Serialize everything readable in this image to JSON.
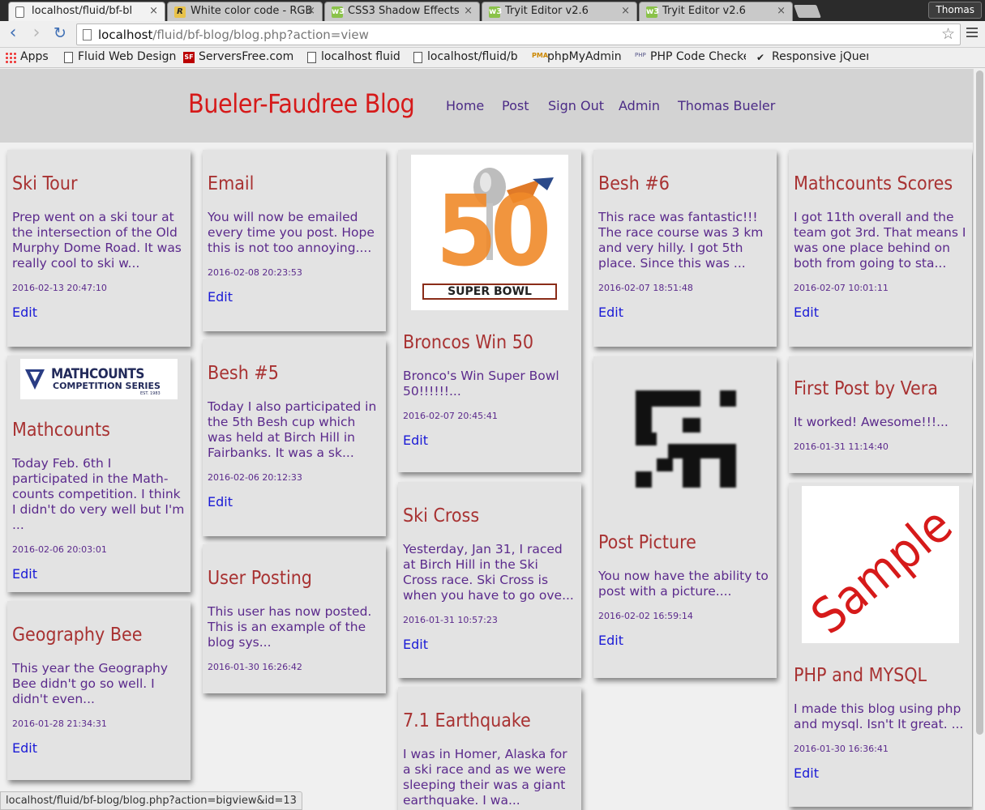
{
  "browser": {
    "tabs": [
      {
        "title": "localhost/fluid/bf-bl",
        "icon": "page-icon",
        "active": true
      },
      {
        "title": "White color code - RGB",
        "icon": "r-logo-icon"
      },
      {
        "title": "CSS3 Shadow Effects",
        "icon": "w3-logo-icon"
      },
      {
        "title": "Tryit Editor v2.6",
        "icon": "w3-logo-icon"
      },
      {
        "title": "Tryit Editor v2.6",
        "icon": "w3-logo-icon"
      }
    ],
    "profile_name": "Thomas",
    "url_host": "localhost",
    "url_path": "/fluid/bf-blog/blog.php?action=view",
    "bookmarks": [
      {
        "label": "Apps",
        "icon": "apps-grid-icon"
      },
      {
        "label": "Fluid Web Design",
        "icon": "page-icon"
      },
      {
        "label": "ServersFree.com",
        "icon": "sf-logo-icon"
      },
      {
        "label": "localhost fluid",
        "icon": "page-icon"
      },
      {
        "label": "localhost/fluid/b",
        "icon": "page-icon"
      },
      {
        "label": "phpMyAdmin",
        "icon": "pma-logo-icon"
      },
      {
        "label": "PHP Code Checker",
        "icon": "php-icon"
      },
      {
        "label": "Responsive jQuery",
        "icon": "r-icon"
      }
    ],
    "status_url": "localhost/fluid/bf-blog/blog.php?action=bigview&id=13"
  },
  "site": {
    "title": "Bueler-Faudree Blog",
    "nav": [
      "Home",
      "Post",
      "Sign Out",
      "Admin",
      "Thomas Bueler"
    ]
  },
  "posts": [
    {
      "title": "Ski Tour",
      "excerpt": "Prep went on a ski tour at the intersection of the Old Murphy Dome Road. It was really cool to ski w...",
      "date": "2016-02-13 20:47:10",
      "edit": "Edit"
    },
    {
      "title": "Mathcounts",
      "excerpt": "Today Feb. 6th I participated in the Math-counts competition. I think I didn't do very well but I'm ...",
      "date": "2016-02-06 20:03:01",
      "edit": "Edit",
      "image_text": "MATHCOUNTS",
      "image_subtext": "COMPETITION SERIES",
      "image_small": "EST. 1983"
    },
    {
      "title": "Geography Bee",
      "excerpt": "This year the Geography Bee didn't go so well. I didn't even...",
      "date": "2016-01-28 21:34:31",
      "edit": "Edit"
    },
    {
      "title": "Email",
      "excerpt": "You will now be emailed every time you post. Hope this is not too annoying....",
      "date": "2016-02-08 20:23:53",
      "edit": "Edit"
    },
    {
      "title": "Besh #5",
      "excerpt": "Today I also participated in the 5th Besh cup which was held at Birch Hill in Fairbanks. It was a sk...",
      "date": "2016-02-06 20:12:33",
      "edit": "Edit"
    },
    {
      "title": "User Posting",
      "excerpt": "This user has now posted. This is an example of the blog sys...",
      "date": "2016-01-30 16:26:42"
    },
    {
      "title": "Broncos Win 50",
      "excerpt": "Bronco's Win Super Bowl 50!!!!!!...",
      "date": "2016-02-07 20:45:41",
      "edit": "Edit",
      "image_text": "50",
      "image_subtext": "SUPER BOWL"
    },
    {
      "title": "Ski Cross",
      "excerpt": "Yesterday, Jan 31, I raced at Birch Hill in the Ski Cross race. Ski Cross is when you have to go ove...",
      "date": "2016-01-31 10:57:23",
      "edit": "Edit"
    },
    {
      "title": "7.1 Earthquake",
      "excerpt": "I was in Homer, Alaska for a ski race and as we were sleeping their was a giant earthquake. I wa..."
    },
    {
      "title": "Besh #6",
      "excerpt": "This race was fantastic!!! The race course was 3 km and very hilly. I got 5th place. Since this was ...",
      "date": "2016-02-07 18:51:48",
      "edit": "Edit"
    },
    {
      "title": "Post Picture",
      "excerpt": "You now have the ability to post with a picture....",
      "date": "2016-02-02 16:59:14",
      "edit": "Edit"
    },
    {
      "title": "Mathcounts Scores",
      "excerpt": "I got 11th overall and the team got 3rd. That means I was one place behind on both from going to sta...",
      "date": "2016-02-07 10:01:11",
      "edit": "Edit"
    },
    {
      "title": "First Post by Vera",
      "excerpt": "It worked! Awesome!!!...",
      "date": "2016-01-31 11:14:40"
    },
    {
      "title": "PHP and MYSQL",
      "excerpt": "I made this blog using php and mysql. Isn't It great. ...",
      "date": "2016-01-30 16:36:41",
      "edit": "Edit",
      "image_text": "Sample"
    }
  ]
}
